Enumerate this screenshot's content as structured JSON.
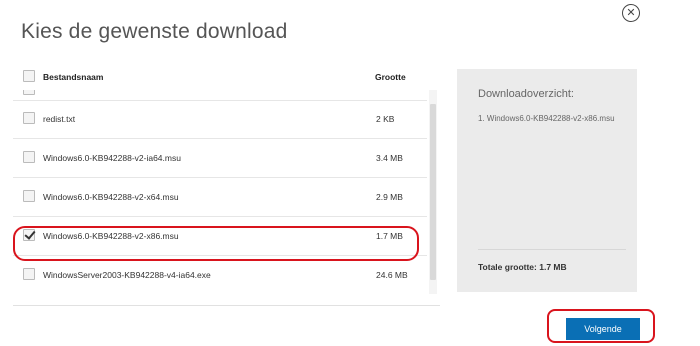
{
  "dialog": {
    "title": "Kies de gewenste download",
    "close_icon": "close-circle-icon"
  },
  "list": {
    "header": {
      "name": "Bestandsnaam",
      "size": "Grootte",
      "select_all_checked": false
    },
    "rows": [
      {
        "name": "redist.txt",
        "size": "2 KB",
        "checked": false
      },
      {
        "name": "Windows6.0-KB942288-v2-ia64.msu",
        "size": "3.4 MB",
        "checked": false
      },
      {
        "name": "Windows6.0-KB942288-v2-x64.msu",
        "size": "2.9 MB",
        "checked": false
      },
      {
        "name": "Windows6.0-KB942288-v2-x86.msu",
        "size": "1.7 MB",
        "checked": true
      },
      {
        "name": "WindowsServer2003-KB942288-v4-ia64.exe",
        "size": "24.6 MB",
        "checked": false
      }
    ]
  },
  "summary": {
    "title": "Downloadoverzicht:",
    "items": [
      "1. Windows6.0-KB942288-v2-x86.msu"
    ],
    "total": "Totale grootte: 1.7 MB"
  },
  "footer": {
    "next_label": "Volgende"
  },
  "colors": {
    "accent": "#0a6fb5",
    "annotation": "#d9141d",
    "panel": "#ebebeb"
  }
}
